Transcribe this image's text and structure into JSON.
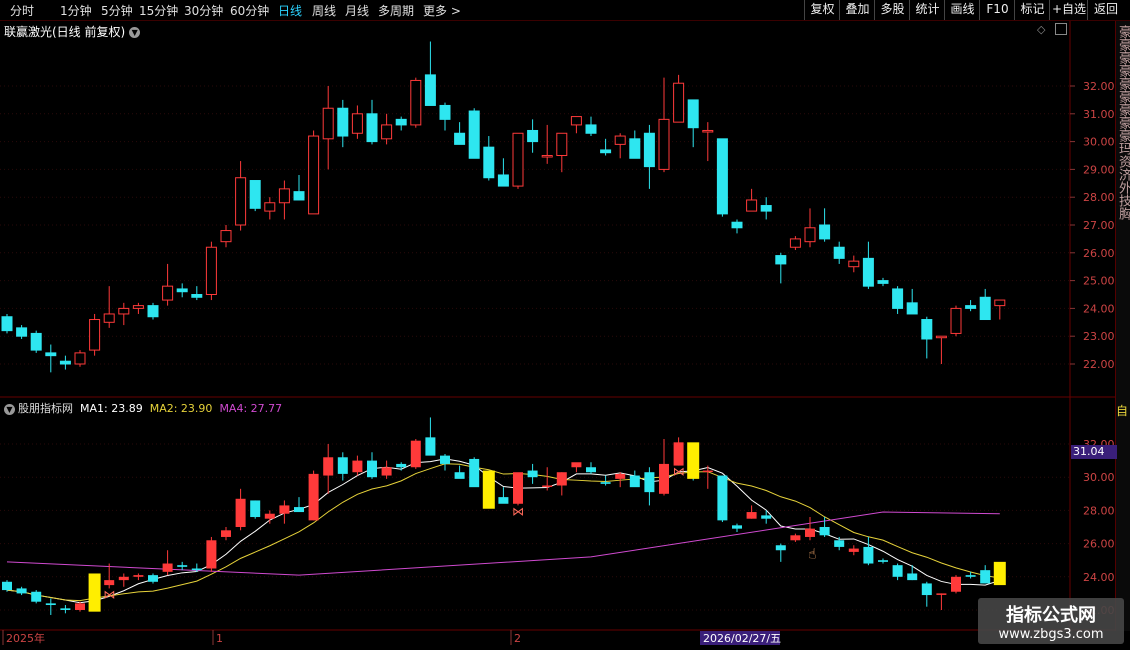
{
  "toolbar": {
    "tabs": [
      "分时",
      "1分钟",
      "5分钟",
      "15分钟",
      "30分钟",
      "60分钟",
      "日线",
      "周线",
      "月线",
      "多周期",
      "更多 >"
    ],
    "active_tab": "日线",
    "right_buttons": [
      "复权",
      "叠加",
      "多股",
      "统计",
      "画线",
      "F10",
      "标记",
      "+自选",
      "返回"
    ]
  },
  "chart_title": "联赢激光(日线 前复权)",
  "indicator": {
    "name": "股朋指标网",
    "ma1_label": "MA1: 23.89",
    "ma2_label": "MA2: 23.90",
    "ma4_label": "MA4: 27.77",
    "price_tag": "31.04"
  },
  "x_axis": {
    "start": "2025年",
    "m1": "1",
    "m2": "2",
    "cursor_date": "2026/02/27/五"
  },
  "side_panel_text": "豪豪豪豪豪豪豪豪豪玛资济外技胸",
  "side_panel_lower": "自",
  "watermark": {
    "line1": "指标公式网",
    "line2": "www.zbgs3.com"
  },
  "colors": {
    "up": "#ff3a3a",
    "down": "#2ee6f0",
    "ma1": "#ffffff",
    "ma2": "#e6d23a",
    "ma4": "#d04ad0",
    "signal": "#ffee00"
  },
  "chart_data": {
    "type": "candlestick",
    "y_ticks": [
      22,
      23,
      24,
      25,
      26,
      27,
      28,
      29,
      30,
      31,
      32
    ],
    "y_tick_labels": [
      "22.00",
      "23.00",
      "24.00",
      "25.00",
      "26.00",
      "27.00",
      "28.00",
      "29.00",
      "30.00",
      "31.00",
      "32.00"
    ],
    "lower_y_ticks": [
      22,
      24,
      26,
      28,
      30,
      32
    ],
    "lower_y_tick_labels": [
      "22.00",
      "24.00",
      "26.00",
      "28.00",
      "30.00",
      "32.00"
    ],
    "ohlc": [
      [
        23.7,
        23.8,
        23.1,
        23.2
      ],
      [
        23.3,
        23.4,
        22.9,
        23.0
      ],
      [
        23.1,
        23.2,
        22.4,
        22.5
      ],
      [
        22.4,
        22.7,
        21.7,
        22.3
      ],
      [
        22.1,
        22.3,
        21.8,
        22.0
      ],
      [
        22.0,
        22.5,
        21.9,
        22.4
      ],
      [
        22.5,
        23.8,
        22.3,
        23.6
      ],
      [
        23.5,
        24.8,
        23.3,
        23.8
      ],
      [
        23.8,
        24.2,
        23.4,
        24.0
      ],
      [
        24.0,
        24.2,
        23.8,
        24.1
      ],
      [
        24.1,
        24.2,
        23.6,
        23.7
      ],
      [
        24.3,
        25.6,
        24.1,
        24.8
      ],
      [
        24.7,
        24.9,
        24.4,
        24.6
      ],
      [
        24.5,
        24.8,
        24.3,
        24.4
      ],
      [
        24.5,
        26.4,
        24.3,
        26.2
      ],
      [
        26.4,
        27.0,
        26.2,
        26.8
      ],
      [
        27.0,
        29.3,
        26.8,
        28.7
      ],
      [
        28.6,
        28.6,
        27.5,
        27.6
      ],
      [
        27.5,
        28.0,
        27.2,
        27.8
      ],
      [
        27.8,
        28.6,
        27.2,
        28.3
      ],
      [
        28.2,
        28.8,
        27.9,
        27.9
      ],
      [
        27.4,
        30.4,
        27.4,
        30.2
      ],
      [
        30.1,
        32.0,
        29.0,
        31.2
      ],
      [
        31.2,
        31.5,
        29.8,
        30.2
      ],
      [
        30.3,
        31.3,
        30.1,
        31.0
      ],
      [
        31.0,
        31.5,
        29.9,
        30.0
      ],
      [
        30.1,
        31.0,
        29.9,
        30.6
      ],
      [
        30.8,
        30.9,
        30.4,
        30.6
      ],
      [
        30.6,
        32.3,
        30.5,
        32.2
      ],
      [
        32.4,
        33.6,
        32.3,
        31.3
      ],
      [
        31.3,
        31.4,
        30.4,
        30.8
      ],
      [
        30.3,
        30.7,
        30.0,
        29.9
      ],
      [
        31.1,
        31.2,
        30.6,
        29.4
      ],
      [
        29.8,
        30.2,
        28.6,
        28.7
      ],
      [
        28.8,
        29.4,
        28.5,
        28.4
      ],
      [
        28.4,
        29.8,
        28.3,
        30.3
      ],
      [
        30.4,
        30.8,
        29.6,
        30.0
      ],
      [
        29.5,
        30.6,
        29.2,
        29.5
      ],
      [
        29.5,
        30.3,
        28.9,
        30.3
      ],
      [
        30.6,
        30.8,
        30.3,
        30.9
      ],
      [
        30.6,
        30.9,
        30.2,
        30.3
      ],
      [
        29.7,
        30.1,
        29.5,
        29.6
      ],
      [
        29.9,
        30.3,
        29.4,
        30.2
      ],
      [
        30.1,
        30.4,
        29.6,
        29.4
      ],
      [
        30.3,
        30.6,
        28.3,
        29.1
      ],
      [
        29.0,
        32.3,
        28.9,
        30.8
      ],
      [
        30.7,
        32.4,
        30.7,
        32.1
      ],
      [
        31.5,
        31.5,
        29.8,
        30.5
      ],
      [
        30.4,
        30.7,
        29.3,
        30.4
      ],
      [
        30.1,
        30.1,
        27.3,
        27.4
      ],
      [
        27.1,
        27.2,
        26.7,
        26.9
      ],
      [
        27.5,
        28.3,
        27.5,
        27.9
      ],
      [
        27.7,
        28.0,
        27.2,
        27.5
      ],
      [
        25.9,
        26.0,
        24.9,
        25.6
      ],
      [
        26.2,
        26.6,
        26.1,
        26.5
      ],
      [
        26.4,
        27.6,
        26.2,
        26.9
      ],
      [
        27.0,
        27.6,
        26.4,
        26.5
      ],
      [
        26.2,
        26.4,
        25.6,
        25.8
      ],
      [
        25.5,
        25.9,
        25.3,
        25.7
      ],
      [
        25.8,
        26.4,
        24.7,
        24.8
      ],
      [
        25.0,
        25.1,
        24.8,
        24.9
      ],
      [
        24.7,
        24.8,
        23.8,
        24.0
      ],
      [
        24.2,
        24.7,
        23.8,
        23.8
      ],
      [
        23.6,
        23.7,
        22.2,
        22.9
      ],
      [
        23.0,
        23.0,
        22.0,
        23.0
      ],
      [
        23.1,
        24.1,
        23.0,
        24.0
      ],
      [
        24.1,
        24.3,
        23.9,
        24.0
      ],
      [
        24.4,
        24.7,
        23.6,
        23.6
      ],
      [
        24.1,
        24.3,
        23.6,
        24.3
      ]
    ],
    "ma4_line": [
      [
        0,
        24.9
      ],
      [
        20,
        24.1
      ],
      [
        40,
        25.2
      ],
      [
        60,
        27.9
      ],
      [
        68,
        27.8
      ]
    ],
    "signals": {
      "yellow": [
        6,
        33,
        47,
        68
      ],
      "butterfly": [
        7,
        35,
        46
      ],
      "hand_cursor": 55
    }
  }
}
